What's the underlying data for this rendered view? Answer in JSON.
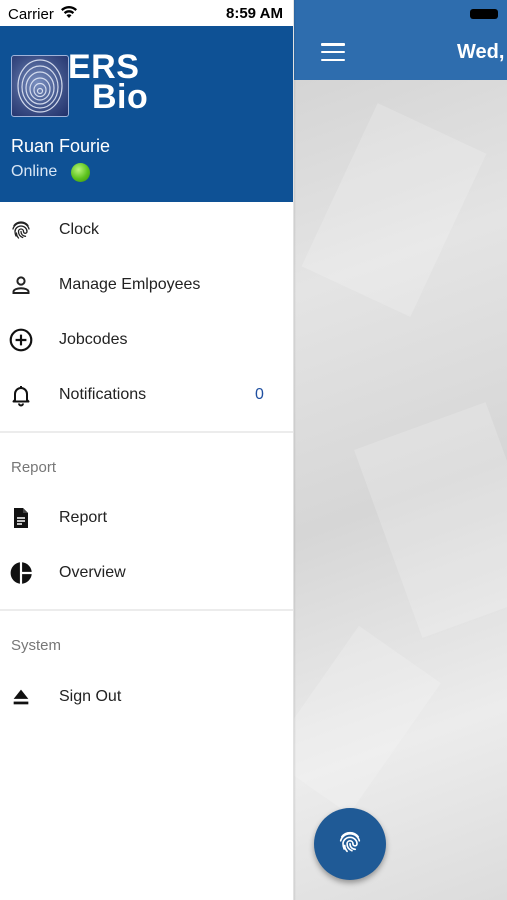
{
  "status_bar": {
    "carrier": "Carrier",
    "time": "8:59 AM"
  },
  "drawer": {
    "logo": {
      "line1": "ERS",
      "line2": "Bio"
    },
    "user": {
      "name": "Ruan Fourie",
      "status": "Online"
    },
    "items": [
      {
        "label": "Clock",
        "icon": "fingerprint-icon"
      },
      {
        "label": "Manage Emlpoyees",
        "icon": "person-icon"
      },
      {
        "label": "Jobcodes",
        "icon": "add-circle-icon"
      },
      {
        "label": "Notifications",
        "icon": "bell-icon",
        "count": "0"
      }
    ],
    "report_section": {
      "title": "Report",
      "items": [
        {
          "label": "Report",
          "icon": "document-icon"
        },
        {
          "label": "Overview",
          "icon": "pie-chart-icon"
        }
      ]
    },
    "system_section": {
      "title": "System",
      "items": [
        {
          "label": "Sign Out",
          "icon": "eject-icon"
        }
      ]
    }
  },
  "app": {
    "date_partial": "Wed,"
  },
  "colors": {
    "header_blue": "#0E5195",
    "topbar_blue": "#2E6DAE",
    "fab_blue": "#1F5A96",
    "badge_blue": "#1F4FA0",
    "online_green": "#5CC21D"
  }
}
